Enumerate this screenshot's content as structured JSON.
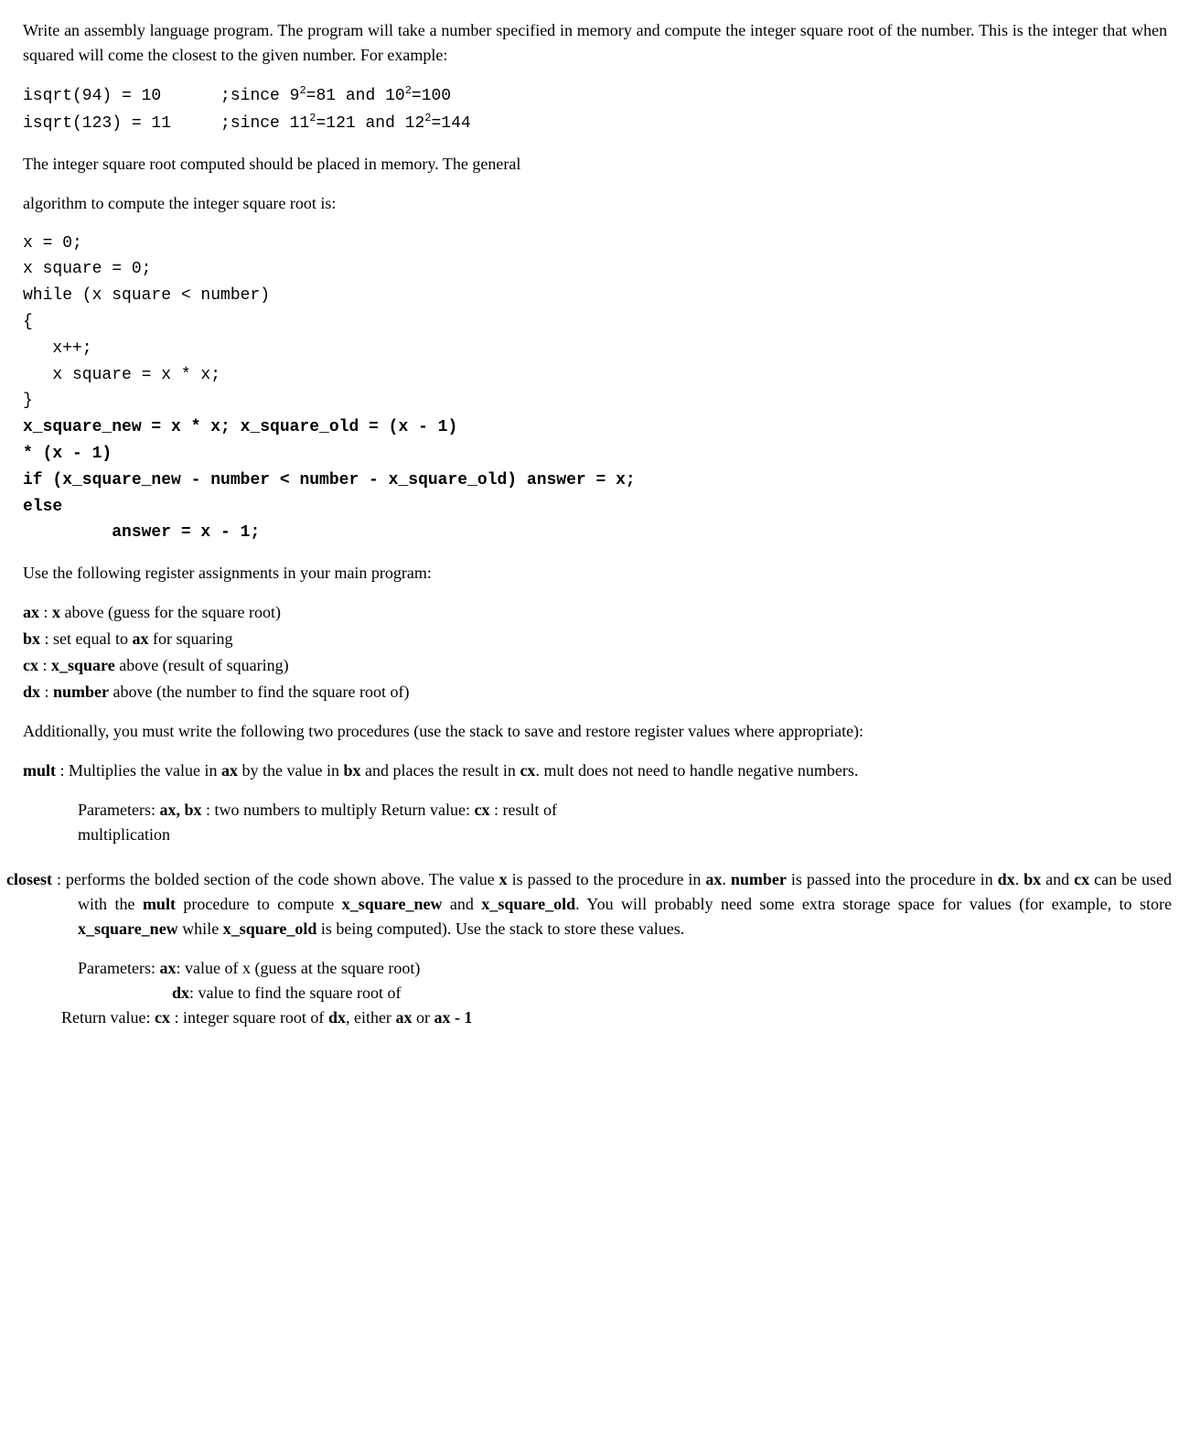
{
  "intro": "Write an assembly language program. The program will take a number specified in memory and compute the integer square root of the number. This is the integer that when squared will come the closest to the given number. For example:",
  "example1_left": "isqrt(94) = 10",
  "example1_comment": ";since 9",
  "example1_mid": "=81 and 10",
  "example1_end": "=100",
  "example2_left": "isqrt(123) = 11",
  "example2_comment": ";since 11",
  "example2_mid": "=121 and 12",
  "example2_end": "=144",
  "para2": "The integer square root computed should be placed in memory. The general",
  "para3": "algorithm to compute the integer square root is:",
  "algo_plain": "x = 0;\nx square = 0;\nwhile (x square < number)\n{\n   x++;\n   x square = x * x;\n}",
  "algo_bold1": "x_square_new = x * x; x_square_old = (x - 1)",
  "algo_bold2": "* (x - 1)",
  "algo_bold3": "if (x_square_new - number < number - x_square_old) answer = x;",
  "algo_bold4": "else",
  "algo_bold5": "         answer = x - 1;",
  "para4": "Use the following register assignments in your main program:",
  "reg_ax_b": "ax",
  "reg_ax_sep": " : ",
  "reg_ax_b2": "x",
  "reg_ax_rest": " above (guess for the square root)",
  "reg_bx_b": "bx",
  "reg_bx_sep": " : set equal to ",
  "reg_bx_b2": "ax",
  "reg_bx_rest": " for squaring",
  "reg_cx_b": "cx",
  "reg_cx_sep": " : ",
  "reg_cx_b2": "x_square",
  "reg_cx_rest": " above (result of squaring)",
  "reg_dx_b": "dx",
  "reg_dx_sep": " : ",
  "reg_dx_b2": "number",
  "reg_dx_rest": " above (the number to find the square root of)",
  "para5": "Additionally, you must write the following two procedures (use the stack to save and restore register values where appropriate):",
  "mult_label": "mult",
  "mult_text1": " : Multiplies the value in ",
  "mult_ax": "ax",
  "mult_text2": " by the value in ",
  "mult_bx": "bx",
  "mult_text3": " and places the result in ",
  "mult_cx": "cx",
  "mult_text4": ". mult does not need to handle negative numbers.",
  "mult_params1": "Parameters: ",
  "mult_params_b": "ax, bx",
  "mult_params2": " : two numbers to multiply Return value: ",
  "mult_params_b2": "cx",
  "mult_params3": " : result of multiplication",
  "closest_label": "closest",
  "closest_text1": " : performs the bolded section of the code shown above. The value ",
  "closest_x": "x",
  "closest_text2": " is passed to the procedure in ",
  "closest_ax": "ax",
  "closest_text3": ". ",
  "closest_number": "number",
  "closest_text4": " is passed into the procedure in ",
  "closest_dx": "dx",
  "closest_text5": ". ",
  "closest_bx": "bx",
  "closest_text6": " and ",
  "closest_cx": "cx",
  "closest_text7": " can be used with the ",
  "closest_mult": "mult",
  "closest_text8": " procedure to compute ",
  "closest_xsn": "x_square_new",
  "closest_text9": " and ",
  "closest_xso": "x_square_old",
  "closest_text10": ". You will probably need some extra storage space for values (for example, to store ",
  "closest_xsn2": "x_square_new",
  "closest_text11": " while ",
  "closest_xso2": "x_square_old",
  "closest_text12": " is being computed). Use the stack to store these values.",
  "closest_params1": "Parameters: ",
  "closest_params_ax": "ax",
  "closest_params2": ": value of x (guess at the square root)",
  "closest_params_dx": "dx",
  "closest_params3": ": value to find the square root of",
  "closest_return1": "Return value: ",
  "closest_return_cx": "cx",
  "closest_return2": " : integer square root of ",
  "closest_return_dx": "dx",
  "closest_return3": ", either ",
  "closest_return_ax": "ax",
  "closest_return4": " or ",
  "closest_return_ax2": "ax - 1",
  "sup2": "2"
}
